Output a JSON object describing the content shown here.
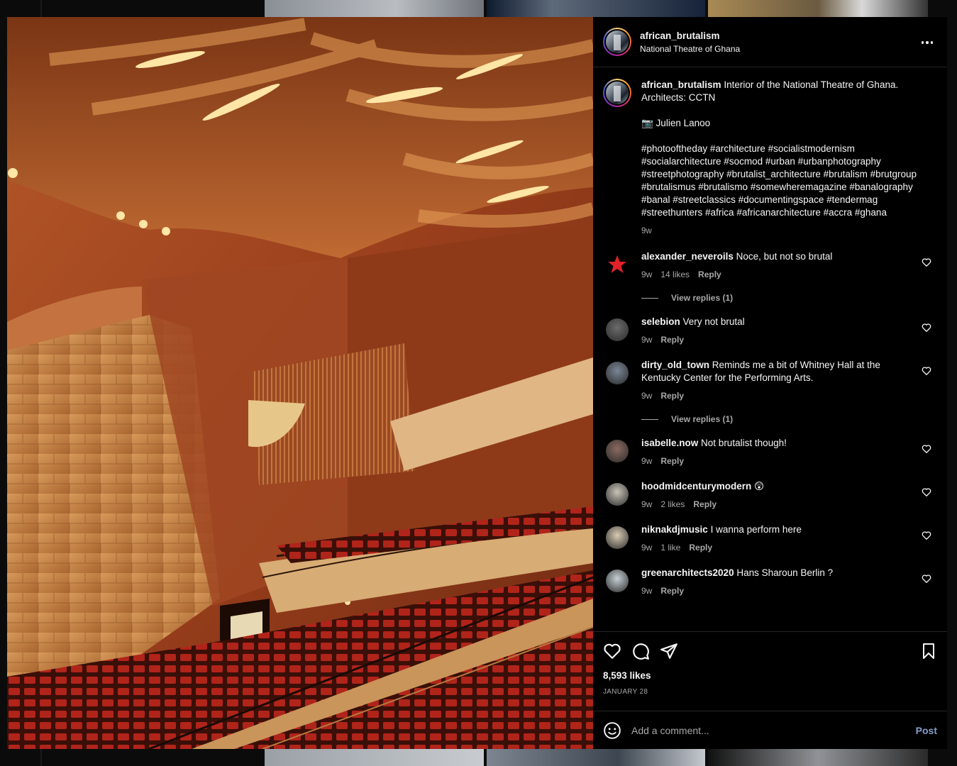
{
  "post": {
    "username": "african_brutalism",
    "location": "National Theatre of Ghana",
    "photo_alt": "Interior of the National Theatre of Ghana",
    "caption": {
      "username": "african_brutalism",
      "text": "Interior of the National Theatre of Ghana. Architects: CCTN",
      "credit": "📷 Julien Lanoo",
      "hashtags": "#photooftheday #architecture #socialistmodernism #socialarchitecture #socmod #urban #urbanphotography #streetphotography #brutalist_architecture #brutalism #brutgroup #brutalismus #brutalismo #somewheremagazine #banalography #banal #streetclassics #documentingspace #tendermag #streethunters #africa #africanarchitecture #accra #ghana",
      "time": "9w"
    },
    "comments": [
      {
        "username": "alexander_neveroils",
        "text": "Noce, but not so brutal",
        "time": "9w",
        "likes": "14 likes",
        "reply": "Reply",
        "view_replies": "View replies (1)",
        "avatar_color": "#000000"
      },
      {
        "username": "selebion",
        "text": "Very not brutal",
        "time": "9w",
        "likes": "",
        "reply": "Reply",
        "view_replies": "",
        "avatar_color": "#6b6b6b"
      },
      {
        "username": "dirty_old_town",
        "text": "Reminds me a bit of Whitney Hall at the Kentucky Center for the Performing Arts.",
        "time": "9w",
        "likes": "",
        "reply": "Reply",
        "view_replies": "View replies (1)",
        "avatar_color": "#7a8696"
      },
      {
        "username": "isabelle.now",
        "text": "Not brutalist though!",
        "time": "9w",
        "likes": "",
        "reply": "Reply",
        "view_replies": "",
        "avatar_color": "#8a6a60"
      },
      {
        "username": "hoodmidcenturymodern",
        "text": "😲",
        "time": "9w",
        "likes": "2 likes",
        "reply": "Reply",
        "view_replies": "",
        "avatar_color": "#c9c4b8"
      },
      {
        "username": "niknakdjmusic",
        "text": "I wanna perform here",
        "time": "9w",
        "likes": "1 like",
        "reply": "Reply",
        "view_replies": "",
        "avatar_color": "#d9cbb4"
      },
      {
        "username": "greenarchitects2020",
        "text": "Hans Sharoun Berlin ?",
        "time": "9w",
        "likes": "",
        "reply": "Reply",
        "view_replies": "",
        "avatar_color": "#c7d0d6"
      }
    ],
    "likes": "8,593 likes",
    "date": "JANUARY 28",
    "add_comment_placeholder": "Add a comment...",
    "post_label": "Post"
  }
}
